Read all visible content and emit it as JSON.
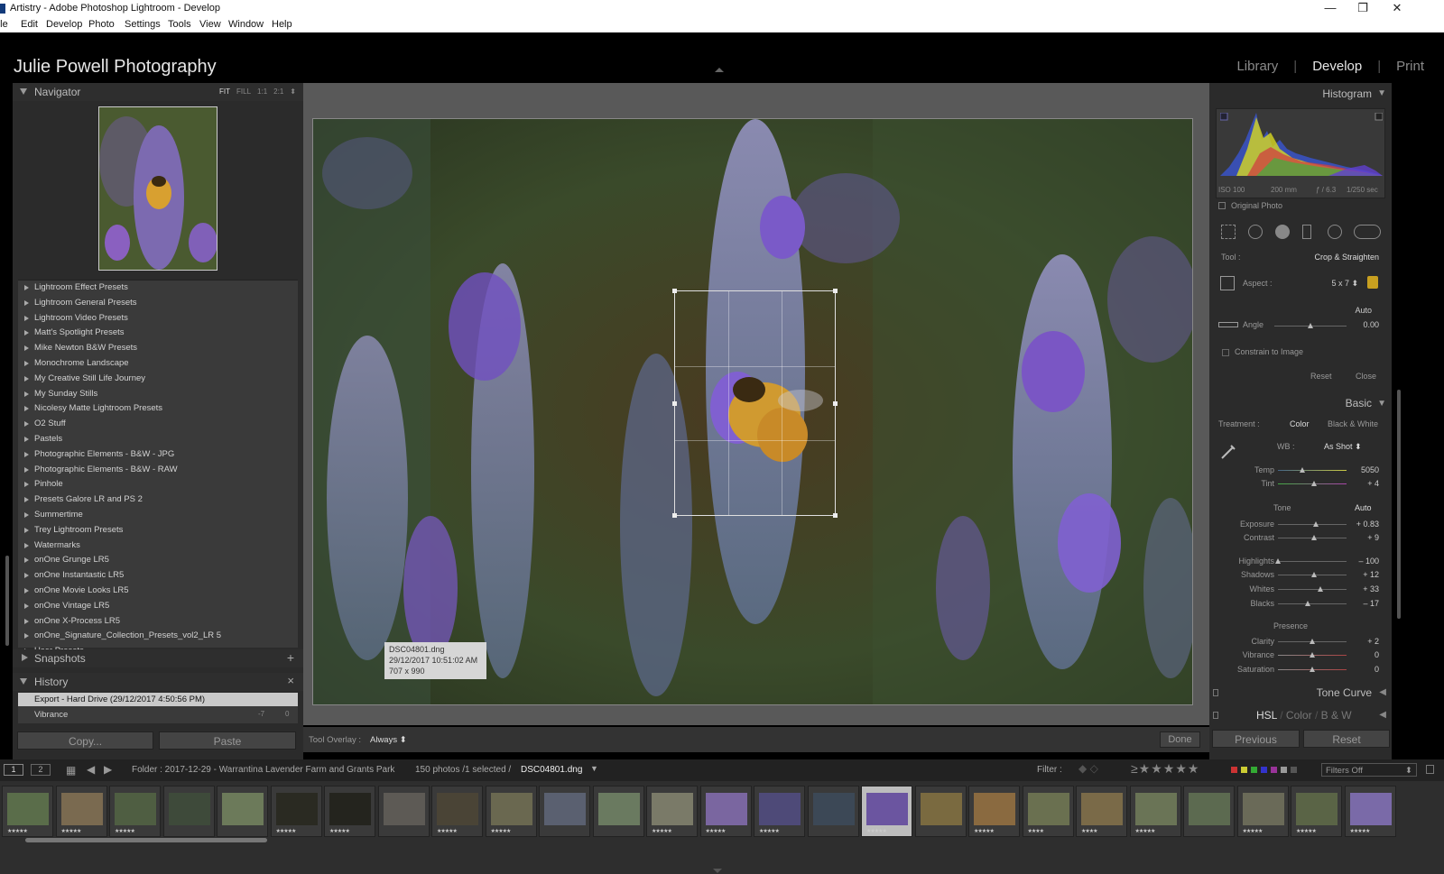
{
  "window": {
    "title": "Artistry - Adobe Photoshop Lightroom - Develop"
  },
  "menu": [
    "File",
    "Edit",
    "Develop",
    "Photo",
    "Settings",
    "Tools",
    "View",
    "Window",
    "Help"
  ],
  "identity_plate": "Julie Powell Photography",
  "modules": {
    "library": "Library",
    "develop": "Develop",
    "print": "Print",
    "active": "Develop"
  },
  "navigator": {
    "title": "Navigator",
    "zoom": [
      "FIT",
      "FILL",
      "1:1",
      "2:1"
    ],
    "active_zoom": "FIT"
  },
  "presets": [
    "Lightroom Effect Presets",
    "Lightroom General Presets",
    "Lightroom Video Presets",
    "Matt's Spotlight Presets",
    "Mike Newton B&W Presets",
    "Monochrome Landscape",
    "My Creative Still Life Journey",
    "My Sunday Stills",
    "Nicolesy Matte Lightroom Presets",
    "O2 Stuff",
    "Pastels",
    "Photographic Elements - B&W - JPG",
    "Photographic Elements - B&W - RAW",
    "Pinhole",
    "Presets Galore LR and PS 2",
    "Summertime",
    "Trey Lightroom Presets",
    "Watermarks",
    "onOne Grunge LR5",
    "onOne Instantastic LR5",
    "onOne Movie Looks LR5",
    "onOne Vintage LR5",
    "onOne X-Process LR5",
    "onOne_Signature_Collection_Presets_vol2_LR 5",
    "User Presets"
  ],
  "snapshots": {
    "title": "Snapshots",
    "add": "+"
  },
  "history": {
    "title": "History",
    "clear": "×",
    "items": [
      {
        "label": "Export - Hard Drive (29/12/2017 4:50:56 PM)",
        "selected": true
      },
      {
        "label": "Vibrance",
        "from": "-7",
        "to": "0"
      }
    ]
  },
  "left_buttons": {
    "copy": "Copy...",
    "paste": "Paste"
  },
  "info_overlay": {
    "filename": "DSC04801.dng",
    "datetime": "29/12/2017 10:51:02 AM",
    "dimensions": "707 x 990"
  },
  "toolbar": {
    "overlay_label": "Tool Overlay :",
    "overlay_value": "Always",
    "done": "Done"
  },
  "histogram": {
    "title": "Histogram",
    "iso": "ISO 100",
    "focal": "200 mm",
    "aperture": "ƒ / 6.3",
    "shutter": "1/250 sec",
    "original_photo": "Original Photo"
  },
  "crop": {
    "tool_label": "Tool :",
    "tool_value": "Crop & Straighten",
    "aspect_label": "Aspect :",
    "aspect_value": "5 x 7",
    "auto": "Auto",
    "angle_label": "Angle",
    "angle_value": "0.00",
    "constrain": "Constrain to Image",
    "reset": "Reset",
    "close": "Close"
  },
  "basic": {
    "title": "Basic",
    "treatment_label": "Treatment :",
    "color": "Color",
    "bw": "Black & White",
    "wb_label": "WB :",
    "wb_value": "As Shot",
    "tone_label": "Tone",
    "tone_auto": "Auto",
    "presence_label": "Presence",
    "sliders": [
      {
        "label": "Temp",
        "value": "5050",
        "pos": 0.35
      },
      {
        "label": "Tint",
        "value": "+ 4",
        "pos": 0.52
      },
      {
        "label": "Exposure",
        "value": "+ 0.83",
        "pos": 0.55
      },
      {
        "label": "Contrast",
        "value": "+ 9",
        "pos": 0.52
      },
      {
        "label": "Highlights",
        "value": "– 100",
        "pos": 0.0
      },
      {
        "label": "Shadows",
        "value": "+ 12",
        "pos": 0.53
      },
      {
        "label": "Whites",
        "value": "+ 33",
        "pos": 0.62
      },
      {
        "label": "Blacks",
        "value": "– 17",
        "pos": 0.44
      },
      {
        "label": "Clarity",
        "value": "+ 2",
        "pos": 0.5
      },
      {
        "label": "Vibrance",
        "value": "0",
        "pos": 0.5
      },
      {
        "label": "Saturation",
        "value": "0",
        "pos": 0.5
      }
    ]
  },
  "right_panels": {
    "tone_curve": "Tone Curve",
    "hsl": "HSL",
    "color": "Color",
    "bw": "B & W"
  },
  "right_buttons": {
    "previous": "Previous",
    "reset": "Reset"
  },
  "filmbar": {
    "view1": "1",
    "view2": "2",
    "folder": "Folder : 2017-12-29 - Warrantina Lavender Farm and Grants Park",
    "count": "150 photos /1 selected /",
    "file": "DSC04801.dng",
    "filter_label": "Filter :",
    "filters_off": "Filters Off"
  },
  "filmstrip": {
    "thumbs": [
      {
        "stars": "★★★★★",
        "color": "#5a6d4a"
      },
      {
        "stars": "★★★★★",
        "color": "#7a6a50"
      },
      {
        "stars": "★★★★★",
        "color": "#4f5e42"
      },
      {
        "stars": "",
        "color": "#3e4a3a"
      },
      {
        "stars": "",
        "color": "#6c7a5a"
      },
      {
        "stars": "★★★★★",
        "color": "#2a2a22"
      },
      {
        "stars": "★★★★★",
        "color": "#24241e"
      },
      {
        "stars": "",
        "color": "#5d5a55"
      },
      {
        "stars": "★★★★★",
        "color": "#4a4436"
      },
      {
        "stars": "★★★★★",
        "color": "#6a6850"
      },
      {
        "stars": "",
        "color": "#5a6070"
      },
      {
        "stars": "",
        "color": "#6a7a60"
      },
      {
        "stars": "★★★★★",
        "color": "#7a7a68"
      },
      {
        "stars": "★★★★★",
        "color": "#7a66a0"
      },
      {
        "stars": "★★★★★",
        "color": "#4e4a78"
      },
      {
        "stars": "",
        "color": "#3c4856"
      },
      {
        "stars": "★★★★★",
        "color": "#6b55a0"
      },
      {
        "stars": "",
        "color": "#7a6a40"
      },
      {
        "stars": "★★★★★",
        "color": "#8a6a40"
      },
      {
        "stars": "★★★★",
        "color": "#6a7050"
      },
      {
        "stars": "★★★★",
        "color": "#7a6a48"
      },
      {
        "stars": "★★★★★",
        "color": "#6a7456"
      },
      {
        "stars": "",
        "color": "#5c6a50"
      },
      {
        "stars": "★★★★★",
        "color": "#6a6a58"
      },
      {
        "stars": "★★★★★",
        "color": "#5a6446"
      },
      {
        "stars": "★★★★★",
        "color": "#7a6aa8"
      }
    ],
    "selected_index": 16
  }
}
